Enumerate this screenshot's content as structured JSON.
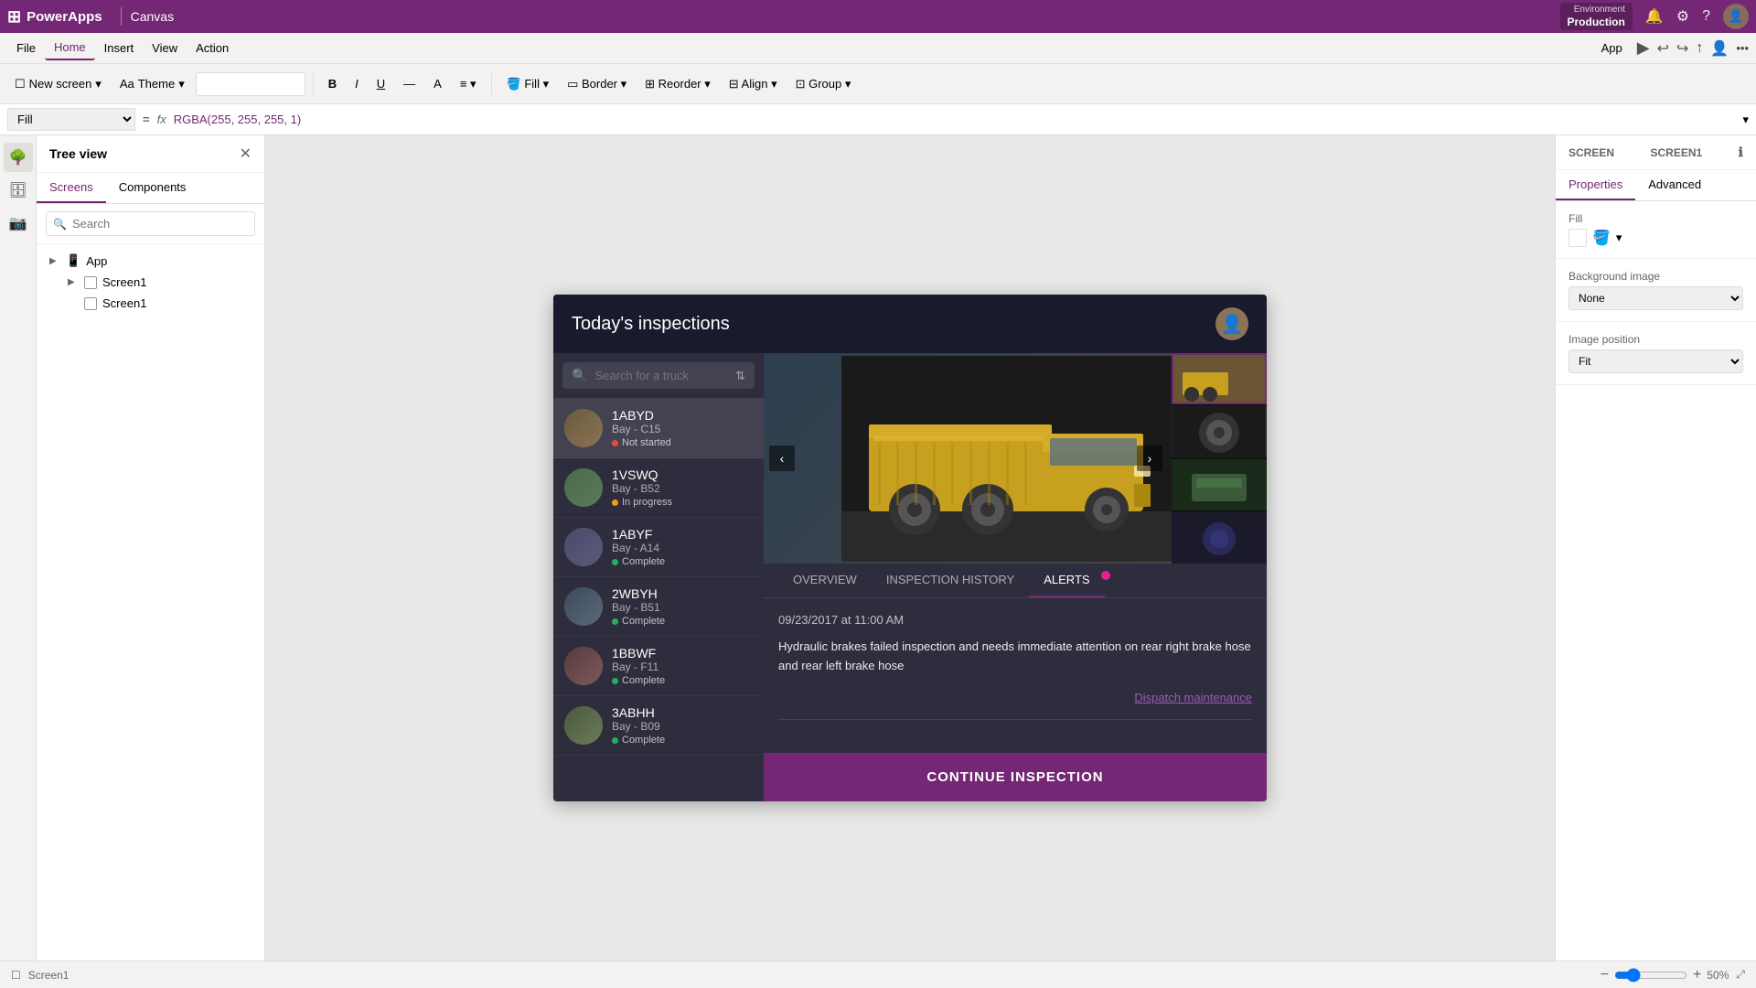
{
  "app": {
    "name": "PowerApps",
    "type": "Canvas",
    "env_label": "Environment",
    "env_name": "Production"
  },
  "menu": {
    "items": [
      "File",
      "Home",
      "Insert",
      "View",
      "Action"
    ],
    "active": "Home"
  },
  "toolbar": {
    "new_screen": "New screen",
    "theme": "Theme",
    "fill_label": "Fill",
    "bold": "B",
    "italic": "I",
    "underline": "U",
    "strikethrough": "—",
    "font_color": "A",
    "align": "≡",
    "fill_btn": "Fill",
    "border": "Border",
    "reorder": "Reorder",
    "align_btn": "Align",
    "group": "Group"
  },
  "formula_bar": {
    "property": "Fill",
    "value": "RGBA(255, 255, 255, 1)"
  },
  "panel": {
    "title": "Tree view",
    "tabs": [
      "Screens",
      "Components"
    ],
    "search_placeholder": "Search",
    "items": [
      {
        "name": "App",
        "type": "app"
      },
      {
        "name": "Screen1",
        "type": "screen",
        "indent": 1
      },
      {
        "name": "Screen1",
        "type": "screen",
        "indent": 1
      }
    ]
  },
  "screen": {
    "id": "Screen1",
    "label": "SCREEN",
    "name": "Screen1"
  },
  "properties_panel": {
    "tabs": [
      "Properties",
      "Advanced"
    ],
    "active": "Properties",
    "fill_label": "Fill",
    "fill_value": "",
    "background_image_label": "Background image",
    "background_image_value": "None",
    "image_position_label": "Image position",
    "image_position_value": "Fit"
  },
  "preview_app": {
    "title": "Today's inspections",
    "search_placeholder": "Search for a truck",
    "trucks": [
      {
        "id": "1ABYD",
        "bay": "Bay - C15",
        "status": "Not started",
        "status_type": "not-started"
      },
      {
        "id": "1VSWQ",
        "bay": "Bay - B52",
        "status": "In progress",
        "status_type": "in-progress"
      },
      {
        "id": "1ABYF",
        "bay": "Bay - A14",
        "status": "Complete",
        "status_type": "complete"
      },
      {
        "id": "2WBYH",
        "bay": "Bay - B51",
        "status": "Complete",
        "status_type": "complete"
      },
      {
        "id": "1BBWF",
        "bay": "Bay - F11",
        "status": "Complete",
        "status_type": "complete"
      },
      {
        "id": "3ABHH",
        "bay": "Bay - B09",
        "status": "Complete",
        "status_type": "complete"
      }
    ],
    "detail": {
      "tabs": [
        "OVERVIEW",
        "INSPECTION HISTORY",
        "ALERTS"
      ],
      "active_tab": "ALERTS",
      "alert_date": "09/23/2017 at 11:00 AM",
      "alert_message": "Hydraulic brakes failed inspection and needs immediate attention on rear right brake hose and rear left brake hose",
      "dispatch_link": "Dispatch maintenance",
      "continue_btn": "CONTINUE INSPECTION"
    }
  },
  "status_bar": {
    "screen": "Screen1",
    "zoom_minus": "−",
    "zoom_plus": "+",
    "zoom_value": "50",
    "zoom_unit": "%",
    "fullscreen": "⤢"
  }
}
